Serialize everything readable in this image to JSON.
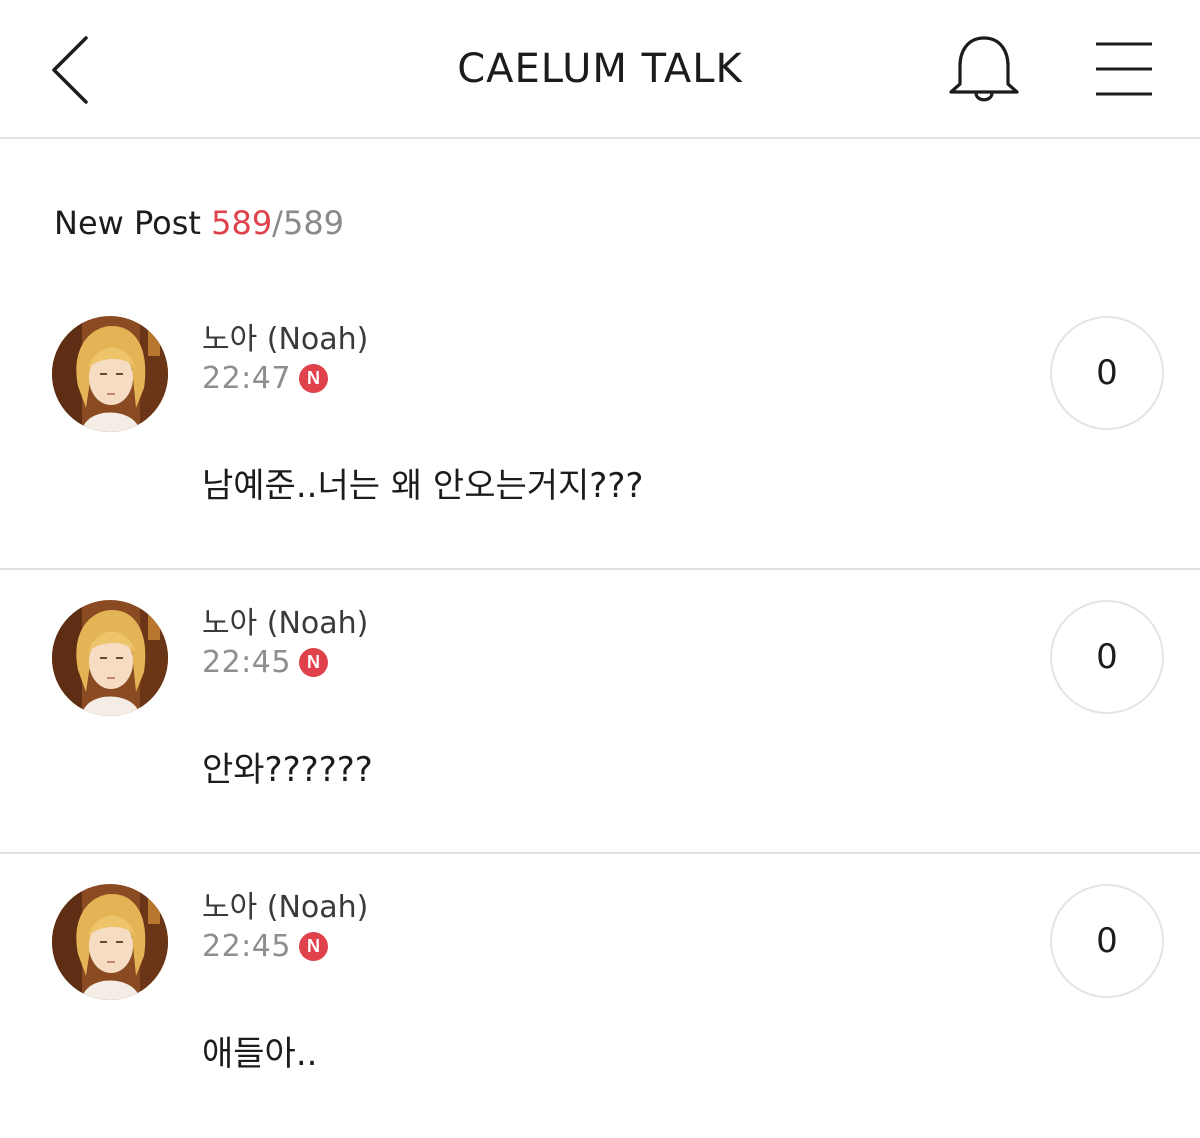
{
  "header": {
    "title": "CAELUM TALK",
    "back_icon": "chevron-left-icon",
    "bell_icon": "bell-icon",
    "menu_icon": "hamburger-menu-icon"
  },
  "new_post": {
    "label": "New Post",
    "new_count": "589",
    "separator": "/",
    "total_count": "589"
  },
  "posts": [
    {
      "author": "노아 (Noah)",
      "time": "22:47",
      "badge": "N",
      "likes": "0",
      "message": "남예준..너는 왜 안오는거지???"
    },
    {
      "author": "노아 (Noah)",
      "time": "22:45",
      "badge": "N",
      "likes": "0",
      "message": "안와??????"
    },
    {
      "author": "노아 (Noah)",
      "time": "22:45",
      "badge": "N",
      "likes": "0",
      "message": "애들아.."
    }
  ],
  "colors": {
    "accent": "#e0424c",
    "muted_text": "#8e8e8e",
    "divider": "#e2e2e2"
  }
}
